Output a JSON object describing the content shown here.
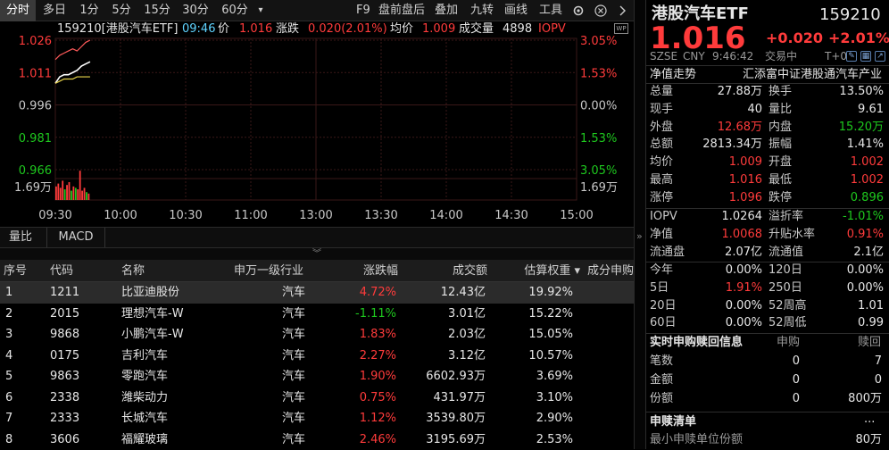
{
  "toolbar": {
    "tabs": [
      "分时",
      "多日",
      "1分",
      "5分",
      "15分",
      "30分",
      "60分"
    ],
    "dropdown": "▾",
    "right_items": [
      "F9",
      "盘前盘后",
      "叠加",
      "九转",
      "画线",
      "工具"
    ],
    "icons": [
      "gear-icon",
      "close-icon",
      "chevron-right-icon"
    ]
  },
  "infobar": {
    "code_name": "159210[港股汽车ETF]",
    "time": "09:46",
    "price_label": "价",
    "price": "1.016",
    "change_label": "涨跌",
    "change": "0.020(2.01%)",
    "avg_label": "均价",
    "avg": "1.009",
    "volume_label": "成交量",
    "volume": "4898",
    "iopv_label": "IOPV"
  },
  "chart_data": {
    "type": "line",
    "title": "",
    "x_ticks": [
      "09:30",
      "10:00",
      "10:30",
      "11:00",
      "13:00",
      "13:30",
      "14:00",
      "14:30",
      "15:00"
    ],
    "y_ticks_left": [
      "1.026",
      "1.011",
      "0.996",
      "0.981",
      "0.966"
    ],
    "y_ticks_right": [
      "3.05%",
      "1.53%",
      "0.00%",
      "1.53%",
      "3.05%"
    ],
    "ylim": [
      0.966,
      1.026
    ],
    "pre_close": 0.996,
    "volume_label_left": "1.69万",
    "volume_label_right": "1.69万",
    "series": [
      {
        "name": "价",
        "color": "#ffffff",
        "x_minutes": [
          0,
          2,
          4,
          6,
          8,
          10,
          12,
          14,
          16
        ],
        "values": [
          1.006,
          1.009,
          1.01,
          1.01,
          1.011,
          1.012,
          1.014,
          1.015,
          1.016
        ]
      },
      {
        "name": "均价",
        "color": "#e8d44a",
        "x_minutes": [
          0,
          2,
          4,
          6,
          8,
          10,
          12,
          14,
          16
        ],
        "values": [
          1.006,
          1.007,
          1.008,
          1.008,
          1.008,
          1.009,
          1.009,
          1.009,
          1.009
        ]
      },
      {
        "name": "IOPV",
        "color": "#ff5a5a",
        "x_minutes": [
          0,
          2,
          4,
          6,
          8,
          10,
          12,
          14,
          16
        ],
        "values": [
          1.017,
          1.019,
          1.02,
          1.021,
          1.022,
          1.021,
          1.023,
          1.025,
          1.026
        ]
      }
    ],
    "volume_bars": [
      {
        "minute": 0,
        "value": 0.35,
        "color": "#ff3b3b"
      },
      {
        "minute": 1,
        "value": 0.45,
        "color": "#ff3b3b"
      },
      {
        "minute": 2,
        "value": 0.3,
        "color": "#ff3b3b"
      },
      {
        "minute": 3,
        "value": 0.55,
        "color": "#ff3b3b"
      },
      {
        "minute": 4,
        "value": 0.25,
        "color": "#1ec81e"
      },
      {
        "minute": 5,
        "value": 0.4,
        "color": "#ff3b3b"
      },
      {
        "minute": 6,
        "value": 0.5,
        "color": "#ff3b3b"
      },
      {
        "minute": 7,
        "value": 0.2,
        "color": "#1ec81e"
      },
      {
        "minute": 8,
        "value": 0.35,
        "color": "#ff3b3b"
      },
      {
        "minute": 9,
        "value": 0.3,
        "color": "#1ec81e"
      },
      {
        "minute": 10,
        "value": 0.25,
        "color": "#ff3b3b"
      },
      {
        "minute": 11,
        "value": 0.9,
        "color": "#ff3b3b"
      },
      {
        "minute": 12,
        "value": 0.2,
        "color": "#ff3b3b"
      },
      {
        "minute": 13,
        "value": 0.3,
        "color": "#ff3b3b"
      },
      {
        "minute": 14,
        "value": 0.15,
        "color": "#1ec81e"
      },
      {
        "minute": 15,
        "value": 0.1,
        "color": "#ff3b3b"
      }
    ]
  },
  "tabs2": [
    "量比",
    "MACD"
  ],
  "table": {
    "headers": [
      "序号",
      "代码",
      "名称",
      "申万一级行业",
      "涨跌幅",
      "成交额",
      "估算权重 ▾",
      "成分申购"
    ],
    "rows": [
      {
        "idx": "1",
        "code": "1211",
        "name": "比亚迪股份",
        "industry": "汽车",
        "chg": "4.72%",
        "dir": "up",
        "amount": "12.43亿",
        "weight": "19.92%"
      },
      {
        "idx": "2",
        "code": "2015",
        "name": "理想汽车-W",
        "industry": "汽车",
        "chg": "-1.11%",
        "dir": "down",
        "amount": "3.01亿",
        "weight": "15.22%"
      },
      {
        "idx": "3",
        "code": "9868",
        "name": "小鹏汽车-W",
        "industry": "汽车",
        "chg": "1.83%",
        "dir": "up",
        "amount": "2.03亿",
        "weight": "15.05%"
      },
      {
        "idx": "4",
        "code": "0175",
        "name": "吉利汽车",
        "industry": "汽车",
        "chg": "2.27%",
        "dir": "up",
        "amount": "3.12亿",
        "weight": "10.57%"
      },
      {
        "idx": "5",
        "code": "9863",
        "name": "零跑汽车",
        "industry": "汽车",
        "chg": "1.90%",
        "dir": "up",
        "amount": "6602.93万",
        "weight": "3.69%"
      },
      {
        "idx": "6",
        "code": "2338",
        "name": "潍柴动力",
        "industry": "汽车",
        "chg": "0.75%",
        "dir": "up",
        "amount": "431.97万",
        "weight": "3.10%"
      },
      {
        "idx": "7",
        "code": "2333",
        "name": "长城汽车",
        "industry": "汽车",
        "chg": "1.12%",
        "dir": "up",
        "amount": "3539.80万",
        "weight": "2.90%"
      },
      {
        "idx": "8",
        "code": "3606",
        "name": "福耀玻璃",
        "industry": "汽车",
        "chg": "2.46%",
        "dir": "up",
        "amount": "3195.69万",
        "weight": "2.53%"
      }
    ]
  },
  "right": {
    "name": "港股汽车ETF",
    "code": "159210",
    "price": "1.016",
    "change": "+0.020",
    "change_pct": "+2.01%",
    "exchange": "SZSE",
    "currency": "CNY",
    "time": "9:46:42",
    "status": "交易中",
    "t0": "T+0",
    "nav_trend_label": "净值走势",
    "fund_company": "汇添富中证港股通汽车产业",
    "stats_left": [
      {
        "label": "总量",
        "value": "27.88万",
        "color": "white"
      },
      {
        "label": "现手",
        "value": "40",
        "color": "white"
      },
      {
        "label": "外盘",
        "value": "12.68万",
        "color": "red"
      },
      {
        "label": "总额",
        "value": "2813.34万",
        "color": "white"
      },
      {
        "label": "均价",
        "value": "1.009",
        "color": "red"
      },
      {
        "label": "最高",
        "value": "1.016",
        "color": "red"
      },
      {
        "label": "涨停",
        "value": "1.096",
        "color": "red"
      }
    ],
    "stats_right": [
      {
        "label": "换手",
        "value": "13.50%",
        "color": "white"
      },
      {
        "label": "量比",
        "value": "9.61",
        "color": "white"
      },
      {
        "label": "内盘",
        "value": "15.20万",
        "color": "green"
      },
      {
        "label": "振幅",
        "value": "1.41%",
        "color": "white"
      },
      {
        "label": "开盘",
        "value": "1.002",
        "color": "red"
      },
      {
        "label": "最低",
        "value": "1.002",
        "color": "red"
      },
      {
        "label": "跌停",
        "value": "0.896",
        "color": "green"
      }
    ],
    "stats2_left": [
      {
        "label": "IOPV",
        "value": "1.0264",
        "color": "white"
      },
      {
        "label": "净值",
        "value": "1.0068",
        "color": "red"
      },
      {
        "label": "流通盘",
        "value": "2.07亿",
        "color": "white"
      }
    ],
    "stats2_right": [
      {
        "label": "溢折率",
        "value": "-1.01%",
        "color": "green"
      },
      {
        "label": "升贴水率",
        "value": "0.91%",
        "color": "red"
      },
      {
        "label": "流通值",
        "value": "2.1亿",
        "color": "white"
      }
    ],
    "perf_left": [
      {
        "label": "今年",
        "value": "0.00%",
        "color": "white"
      },
      {
        "label": "5日",
        "value": "1.91%",
        "color": "red"
      },
      {
        "label": "20日",
        "value": "0.00%",
        "color": "white"
      },
      {
        "label": "60日",
        "value": "0.00%",
        "color": "white"
      }
    ],
    "perf_right": [
      {
        "label": "120日",
        "value": "0.00%",
        "color": "white"
      },
      {
        "label": "250日",
        "value": "0.00%",
        "color": "white"
      },
      {
        "label": "52周高",
        "value": "1.01",
        "color": "white"
      },
      {
        "label": "52周低",
        "value": "0.99",
        "color": "white"
      }
    ],
    "redeem_title": "实时申购赎回信息",
    "redeem_col1": "申购",
    "redeem_col2": "赎回",
    "redeem_rows": [
      {
        "label": "笔数",
        "sub": "0",
        "red": "7"
      },
      {
        "label": "金额",
        "sub": "0",
        "red": "0"
      },
      {
        "label": "份额",
        "sub": "0",
        "red": "800万"
      }
    ],
    "list_title": "申赎清单",
    "list_more": "...",
    "min_unit_label": "最小申赎单位份额",
    "min_unit_value": "80万"
  }
}
